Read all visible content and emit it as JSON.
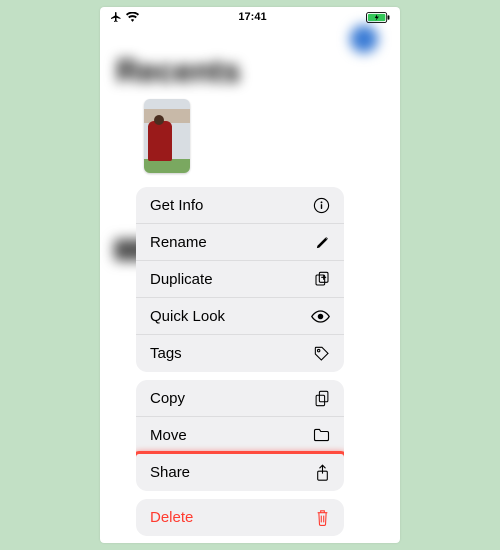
{
  "status": {
    "time": "17:41"
  },
  "background": {
    "title": "Recents"
  },
  "menu": {
    "groups": [
      {
        "items": [
          {
            "key": "getinfo",
            "label": "Get Info",
            "icon": "info"
          },
          {
            "key": "rename",
            "label": "Rename",
            "icon": "pencil"
          },
          {
            "key": "duplicate",
            "label": "Duplicate",
            "icon": "duplicate"
          },
          {
            "key": "quicklook",
            "label": "Quick Look",
            "icon": "eye"
          },
          {
            "key": "tags",
            "label": "Tags",
            "icon": "tag"
          }
        ]
      },
      {
        "items": [
          {
            "key": "copy",
            "label": "Copy",
            "icon": "copy"
          },
          {
            "key": "move",
            "label": "Move",
            "icon": "folder"
          },
          {
            "key": "share",
            "label": "Share",
            "icon": "share",
            "highlighted": true
          }
        ]
      },
      {
        "items": [
          {
            "key": "delete",
            "label": "Delete",
            "icon": "trash",
            "destructive": true
          }
        ]
      }
    ]
  }
}
